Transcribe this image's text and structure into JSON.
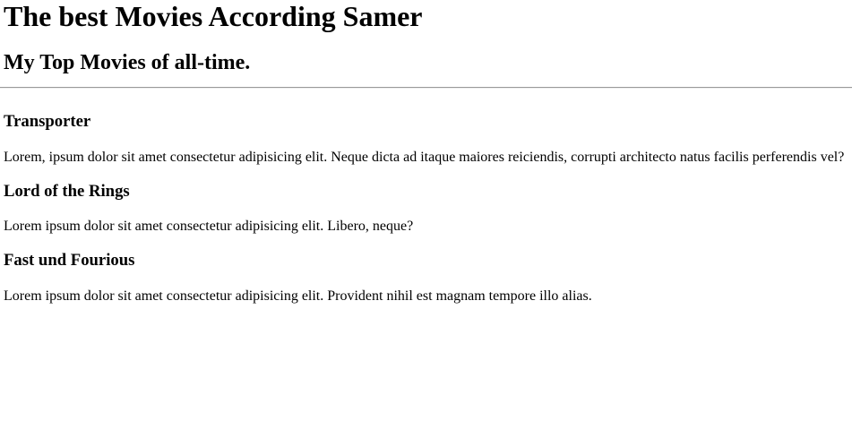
{
  "page": {
    "title": "The best Movies According Samer",
    "subtitle": "My Top Movies of all-time."
  },
  "movies": [
    {
      "title": "Transporter",
      "description": "Lorem, ipsum dolor sit amet consectetur adipisicing elit. Neque dicta ad itaque maiores reiciendis, corrupti architecto natus facilis perferendis vel?"
    },
    {
      "title": "Lord of the Rings",
      "description": "Lorem ipsum dolor sit amet consectetur adipisicing elit. Libero, neque?"
    },
    {
      "title": "Fast und Fourious",
      "description": "Lorem ipsum dolor sit amet consectetur adipisicing elit. Provident nihil est magnam tempore illo alias."
    }
  ]
}
